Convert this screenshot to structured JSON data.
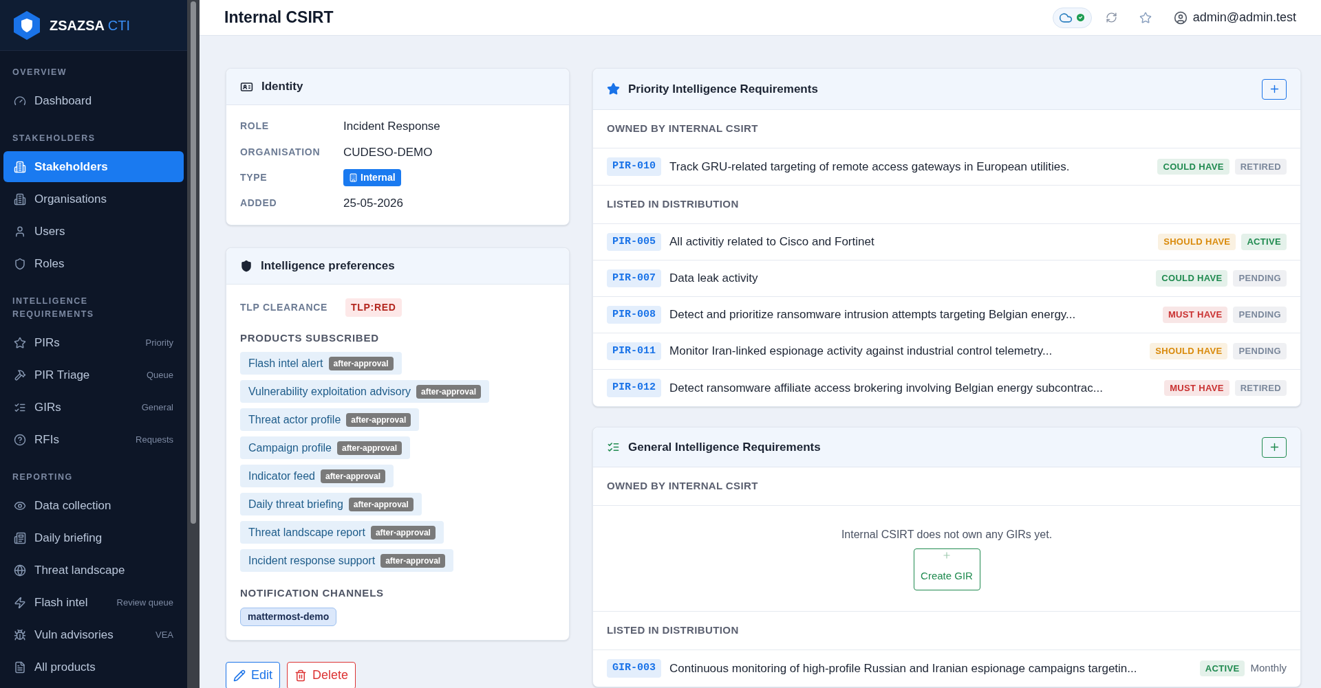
{
  "brand": {
    "name": "ZSAZSA",
    "suffix": "CTI"
  },
  "sidebar": {
    "sections": [
      {
        "title": "OVERVIEW",
        "items": [
          {
            "label": "Dashboard",
            "selected": false
          }
        ]
      },
      {
        "title": "STAKEHOLDERS",
        "items": [
          {
            "label": "Stakeholders",
            "selected": true
          },
          {
            "label": "Organisations",
            "selected": false
          },
          {
            "label": "Users",
            "selected": false
          },
          {
            "label": "Roles",
            "selected": false
          }
        ]
      },
      {
        "title": "INTELLIGENCE REQUIREMENTS",
        "items": [
          {
            "label": "PIRs",
            "hint": "Priority",
            "selected": false
          },
          {
            "label": "PIR Triage",
            "hint": "Queue",
            "selected": false
          },
          {
            "label": "GIRs",
            "hint": "General",
            "selected": false
          },
          {
            "label": "RFIs",
            "hint": "Requests",
            "selected": false
          }
        ]
      },
      {
        "title": "REPORTING",
        "items": [
          {
            "label": "Data collection",
            "selected": false
          },
          {
            "label": "Daily briefing",
            "selected": false
          },
          {
            "label": "Threat landscape",
            "selected": false
          },
          {
            "label": "Flash intel",
            "hint": "Review queue",
            "selected": false
          },
          {
            "label": "Vuln advisories",
            "hint": "VEA",
            "selected": false
          },
          {
            "label": "All products",
            "selected": false
          }
        ]
      }
    ]
  },
  "header": {
    "title": "Internal CSIRT",
    "user": "admin@admin.test"
  },
  "identity": {
    "title": "Identity",
    "fields": [
      {
        "kind": "text",
        "label": "ROLE",
        "value": "Incident Response"
      },
      {
        "kind": "text",
        "label": "ORGANISATION",
        "value": "CUDESO-DEMO"
      },
      {
        "kind": "badge",
        "label": "TYPE",
        "value": "Internal"
      },
      {
        "kind": "text",
        "label": "ADDED",
        "value": "25-05-2026"
      }
    ]
  },
  "preferences": {
    "title": "Intelligence preferences",
    "tlp_label": "TLP CLEARANCE",
    "tlp": "TLP:RED",
    "products_label": "PRODUCTS SUBSCRIBED",
    "products": [
      {
        "name": "Flash intel alert",
        "mode": "after-approval"
      },
      {
        "name": "Vulnerability exploitation advisory",
        "mode": "after-approval"
      },
      {
        "name": "Threat actor profile",
        "mode": "after-approval"
      },
      {
        "name": "Campaign profile",
        "mode": "after-approval"
      },
      {
        "name": "Indicator feed",
        "mode": "after-approval"
      },
      {
        "name": "Daily threat briefing",
        "mode": "after-approval"
      },
      {
        "name": "Threat landscape report",
        "mode": "after-approval"
      },
      {
        "name": "Incident response support",
        "mode": "after-approval"
      }
    ],
    "channels_label": "NOTIFICATION CHANNELS",
    "channels": [
      "mattermost-demo"
    ]
  },
  "actions": [
    {
      "kind": "edit",
      "label": "Edit"
    },
    {
      "kind": "delete",
      "label": "Delete"
    }
  ],
  "pirs": {
    "title": "Priority Intelligence Requirements",
    "groups": [
      {
        "title": "OWNED BY INTERNAL CSIRT",
        "rows": [
          {
            "id": "PIR-010",
            "text": "Track GRU-related targeting of remote access gateways in European utilities.",
            "badges": [
              {
                "text": "COULD HAVE",
                "color": "#1f8a4f"
              },
              {
                "text": "RETIRED",
                "color": "#7a879b"
              }
            ]
          }
        ]
      },
      {
        "title": "LISTED IN DISTRIBUTION",
        "rows": [
          {
            "id": "PIR-005",
            "text": "All activitiy related to Cisco and Fortinet",
            "badges": [
              {
                "text": "SHOULD HAVE",
                "color": "#d98a0b"
              },
              {
                "text": "ACTIVE",
                "color": "#1f8a4f"
              }
            ]
          },
          {
            "id": "PIR-007",
            "text": "Data leak activity",
            "badges": [
              {
                "text": "COULD HAVE",
                "color": "#1f8a4f"
              },
              {
                "text": "PENDING",
                "color": "#7a879b"
              }
            ]
          },
          {
            "id": "PIR-008",
            "text": "Detect and prioritize ransomware intrusion attempts targeting Belgian energy...",
            "badges": [
              {
                "text": "MUST HAVE",
                "color": "#c93030"
              },
              {
                "text": "PENDING",
                "color": "#7a879b"
              }
            ]
          },
          {
            "id": "PIR-011",
            "text": "Monitor Iran-linked espionage activity against industrial control telemetry...",
            "badges": [
              {
                "text": "SHOULD HAVE",
                "color": "#d98a0b"
              },
              {
                "text": "PENDING",
                "color": "#7a879b"
              }
            ]
          },
          {
            "id": "PIR-012",
            "text": "Detect ransomware affiliate access brokering involving Belgian energy subcontrac...",
            "badges": [
              {
                "text": "MUST HAVE",
                "color": "#c93030"
              },
              {
                "text": "RETIRED",
                "color": "#7a879b"
              }
            ]
          }
        ]
      }
    ]
  },
  "girs": {
    "title": "General Intelligence Requirements",
    "owned_title": "OWNED BY INTERNAL CSIRT",
    "empty_text": "Internal CSIRT does not own any GIRs yet.",
    "create_label": "Create GIR",
    "distribution_title": "LISTED IN DISTRIBUTION",
    "rows": [
      {
        "id": "GIR-003",
        "text": "Continuous monitoring of high-profile Russian and Iranian espionage campaigns targetin...",
        "badges": [
          {
            "text": "ACTIVE",
            "color": "#1f8a4f"
          }
        ],
        "frequency": "Monthly"
      }
    ]
  }
}
